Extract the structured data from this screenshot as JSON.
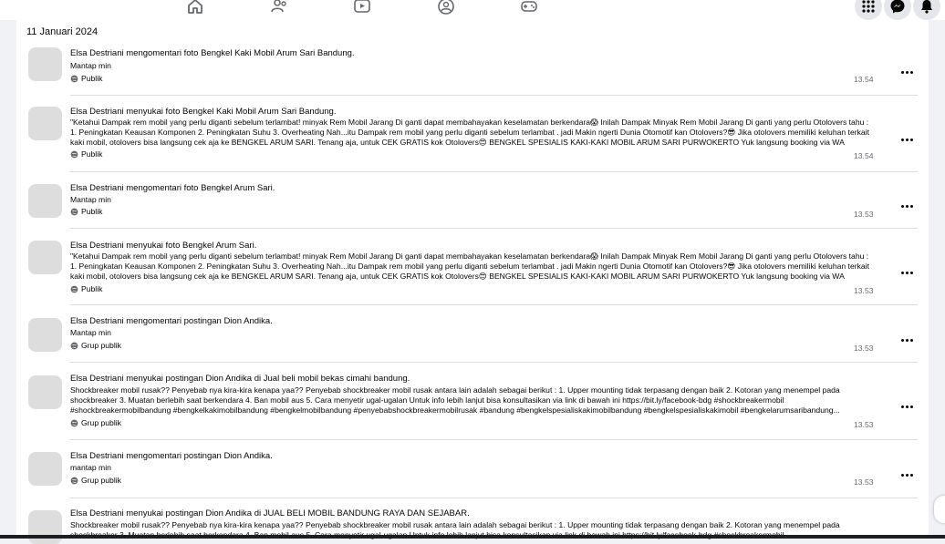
{
  "nav": {
    "icons": [
      "home-icon",
      "friends-icon",
      "video-icon",
      "groups-icon",
      "gaming-icon"
    ],
    "right_icons": [
      "menu-grid-icon",
      "messenger-icon",
      "notifications-icon"
    ]
  },
  "date_heading": "11 Januari 2024",
  "items": [
    {
      "thumb": "car",
      "title": "Elsa Destriani mengomentari foto Bengkel Kaki Mobil Arum Sari Bandung.",
      "body": "Mantap min",
      "privacy": "Publik",
      "time": "13.54"
    },
    {
      "thumb": "car",
      "title": "Elsa Destriani menyukai foto Bengkel Kaki Mobil Arum Sari Bandung.",
      "body": "\"Ketahui Dampak rem mobil yang perlu diganti sebelum terlambat! minyak Rem Mobil Jarang Di ganti dapat membahayakan keselamatan berkendara😱 Inilah Dampak Minyak Rem Mobil Jarang Di ganti yang perlu Otolovers tahu : 1. Peningkatan Keausan Komponen 2. Peningkatan Suhu 3. Overheating Nah...itu Dampak rem mobil yang perlu diganti sebelum terlambat . jadi Makin ngerti Dunia Otomotif kan Otolovers?😎 Jika otolovers memiliki keluhan terkait kaki mobil, otolovers bisa langsung cek aja ke BENGKEL ARUM SARI. Tenang aja, untuk CEK GRATIS kok Otolovers😍 BENGKEL SPESIALIS KAKI-KAKI MOBIL ARUM SARI PURWOKERTO Yuk langsung booking via WA Bengkel...",
      "privacy": "Publik",
      "time": "13.54"
    },
    {
      "thumb": "car",
      "title": "Elsa Destriani mengomentari foto Bengkel Arum Sari.",
      "body": "Mantap min",
      "privacy": "Publik",
      "time": "13.53"
    },
    {
      "thumb": "car",
      "title": "Elsa Destriani menyukai foto Bengkel Arum Sari.",
      "body": "\"Ketahui Dampak rem mobil yang perlu diganti sebelum terlambat! minyak Rem Mobil Jarang Di ganti dapat membahayakan keselamatan berkendara😱 Inilah Dampak Minyak Rem Mobil Jarang Di ganti yang perlu Otolovers tahu : 1. Peningkatan Keausan Komponen 2. Peningkatan Suhu 3. Overheating Nah...itu Dampak rem mobil yang perlu diganti sebelum terlambat . jadi Makin ngerti Dunia Otomotif kan Otolovers?😎 Jika otolovers memiliki keluhan terkait kaki mobil, otolovers bisa langsung cek aja ke BENGKEL ARUM SARI. Tenang aja, untuk CEK GRATIS kok Otolovers😍 BENGKEL SPESIALIS KAKI-KAKI MOBIL ARUM SARI PURWOKERTO Yuk langsung booking via WA Bengkel...",
      "privacy": "Publik",
      "time": "13.53"
    },
    {
      "thumb": "red",
      "title": "Elsa Destriani mengomentari postingan Dion Andika.",
      "body": "Mantap min",
      "privacy": "Grup publik",
      "time": "13.53"
    },
    {
      "thumb": "red",
      "title": "Elsa Destriani menyukai postingan Dion Andika di Jual beli mobil bekas cimahi bandung.",
      "body": "Shockbreaker mobil rusak?? Penyebab nya kira-kira kenapa yaa?? Penyebab shockbreaker mobil rusak antara lain adalah sebagai berikut : 1. Upper mounting tidak terpasang dengan baik 2. Kotoran yang menempel pada shockbreaker 3. Muatan berlebih saat berkendara 4. Ban mobil aus 5. Cara menyetir ugal-ugalan Untuk info lebih lanjut bisa konsultasikan via link di bawah ini https://bit.ly/facebook-bdg #shockbreakermobil #shockbreakermobilbandung #bengkelkakimobilbandung #bengkelmobilbandung #penyebabshockbreakermobilrusak #bandung #bengkelspesialiskakimobilbandung #bengkelspesialiskakimobil #bengkelarumsaribandung...",
      "privacy": "Grup publik",
      "time": "13.53"
    },
    {
      "thumb": "red",
      "title": "Elsa Destriani mengomentari postingan Dion Andika.",
      "body": "mantap min",
      "privacy": "Grup publik",
      "time": "13.53"
    },
    {
      "thumb": "red",
      "title": "Elsa Destriani menyukai postingan Dion Andika di JUAL BELI MOBIL BANDUNG RAYA DAN SEJABAR.",
      "body": "Shockbreaker mobil rusak?? Penyebab nya kira-kira kenapa yaa?? Penyebab shockbreaker mobil rusak antara lain adalah sebagai berikut : 1. Upper mounting tidak terpasang dengan baik 2. Kotoran yang menempel pada shockbreaker 3. Muatan berlebih saat berkendara 4. Ban mobil aus 5. Cara menyetir ugal-ugalan Untuk info lebih lanjut bisa konsultasikan via link di bawah ini https://bit.ly/facebook-bdg #shockbreakermobil",
      "privacy": "",
      "time": ""
    }
  ]
}
